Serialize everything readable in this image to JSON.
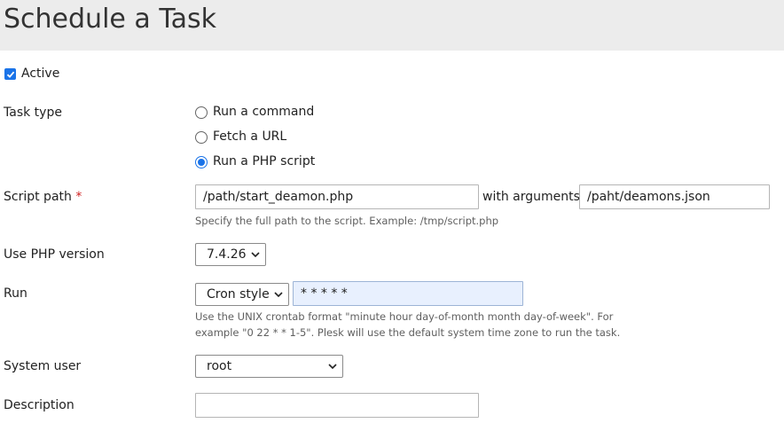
{
  "header": {
    "title": "Schedule a Task"
  },
  "active": {
    "label": "Active",
    "checked": true
  },
  "task_type": {
    "label": "Task type",
    "options": [
      "Run a command",
      "Fetch a URL",
      "Run a PHP script"
    ],
    "selected": "Run a PHP script"
  },
  "script_path": {
    "label": "Script path",
    "required_mark": "*",
    "value": "/path/start_deamon.php",
    "with_arguments_label": "with arguments",
    "arguments_value": "/paht/deamons.json",
    "hint": "Specify the full path to the script. Example: /tmp/script.php"
  },
  "php_version": {
    "label": "Use PHP version",
    "selected": "7.4.26"
  },
  "run": {
    "label": "Run",
    "mode_selected": "Cron style",
    "cron_value": "* * * * *",
    "hint_line1": "Use the UNIX crontab format \"minute hour day-of-month month day-of-week\". For",
    "hint_line2": "example \"0 22 * * 1-5\". Plesk will use the default system time zone to run the task."
  },
  "system_user": {
    "label": "System user",
    "selected": "root"
  },
  "description": {
    "label": "Description",
    "value": ""
  },
  "colors": {
    "accent": "#1a73e8",
    "header_bg": "#ececec",
    "required": "#d02020"
  }
}
